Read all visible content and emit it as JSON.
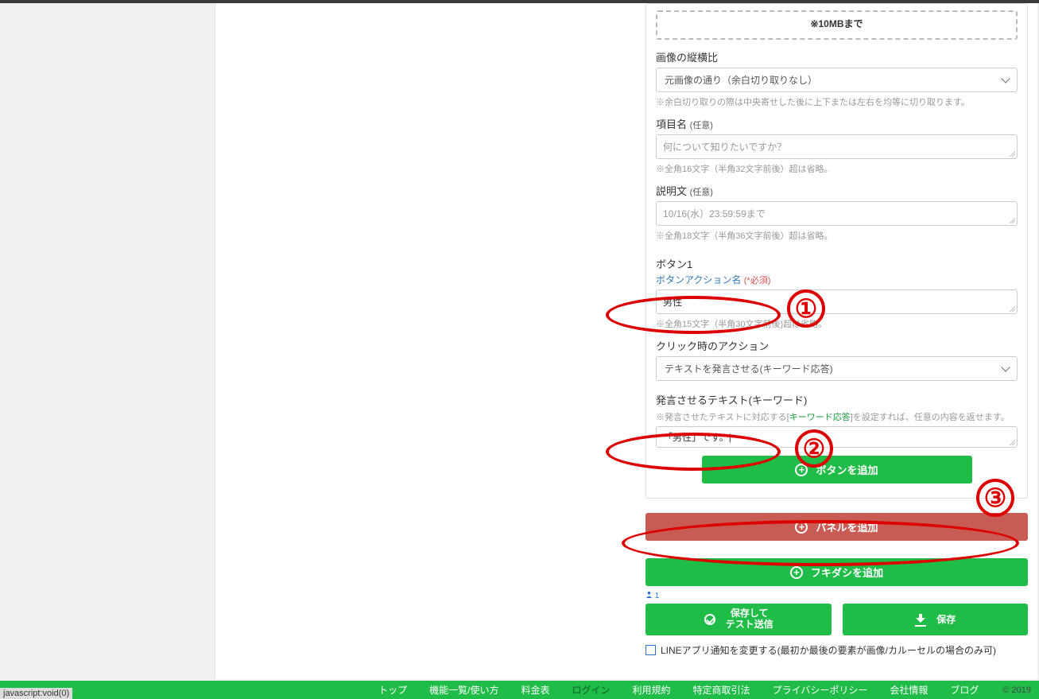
{
  "upload": {
    "note": "※10MBまで"
  },
  "aspect": {
    "label": "画像の縦横比",
    "value": "元画像の通り（余白切り取りなし）",
    "help": "※余白切り取りの際は中央寄せした後に上下または左右を均等に切り取ります。"
  },
  "itemName": {
    "label": "項目名",
    "opt": "(任意)",
    "placeholder": "何について知りたいですか？",
    "help": "※全角16文字（半角32文字前後）超は省略。"
  },
  "description": {
    "label": "説明文",
    "opt": "(任意)",
    "placeholder": "10/16(水）23:59:59まで",
    "help": "※全角18文字（半角36文字前後）超は省略。"
  },
  "button1": {
    "title": "ボタン1",
    "action_name_label": "ボタンアクション名",
    "required": "(*必須)",
    "value": "男性",
    "help": "※全角15文字（半角30文字前後)超は省略。"
  },
  "clickAction": {
    "label": "クリック時のアクション",
    "value": "テキストを発言させる(キーワード応答)"
  },
  "speakText": {
    "label": "発言させるテキスト(キーワード)",
    "help_pre": "※発言させたテキストに対応する[",
    "help_link": "キーワード応答",
    "help_post": "]を設定すれば、任意の内容を返せます。",
    "value": "「男性」です。|"
  },
  "buttons": {
    "addButton": "ボタンを追加",
    "addPanel": "パネルを追加",
    "addBubble": "フキダシを追加"
  },
  "peopleTag": "1",
  "save": {
    "test": "保存して\nテスト送信",
    "save": "保存"
  },
  "checkbox": "LINEアプリ通知を変更する(最初か最後の要素が画像/カルーセルの場合のみ可)",
  "footer": {
    "items": [
      "トップ",
      "機能一覧/使い方",
      "料金表",
      "ログイン",
      "利用規約",
      "特定商取引法",
      "プライバシーポリシー",
      "会社情報",
      "ブログ"
    ],
    "copy": "© 2019"
  },
  "status": "javascript:void(0)",
  "annotations": {
    "n1": "①",
    "n2": "②",
    "n3": "③"
  }
}
